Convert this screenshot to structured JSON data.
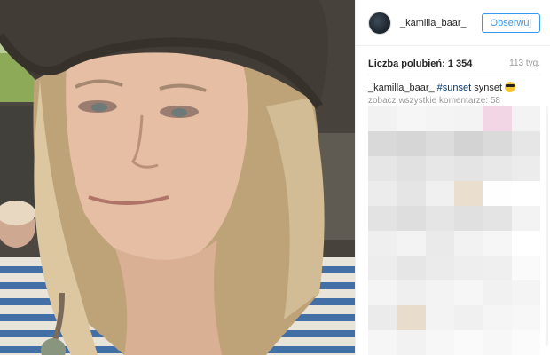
{
  "post": {
    "username": "_kamilla_baar_",
    "follow_label": "Obserwuj",
    "likes_label": "Liczba polubień:",
    "likes_count": "1 354",
    "age": "113 tyg.",
    "caption": {
      "user": "_kamilla_baar_",
      "hashtag": "#sunset",
      "text": "synset",
      "emoji": "sunglasses-emoji"
    },
    "view_all_comments": "zobacz wszystkie komentarze: 58"
  },
  "colors": {
    "accent": "#3897f0",
    "hashtag": "#003569",
    "muted": "#999999",
    "text": "#262626"
  },
  "blur_cells": [
    "#f2f2f2",
    "#f6f6f6",
    "#f4f4f4",
    "#f3f3f3",
    "#f3d6e6",
    "#f3f3f3",
    "#d9d9d9",
    "#d6d6d6",
    "#dcdcdc",
    "#d3d3d3",
    "#dadada",
    "#e6e6e6",
    "#e6e6e6",
    "#e1e1e1",
    "#e7e7e7",
    "#e4e4e4",
    "#e8e8e8",
    "#ececec",
    "#ececec",
    "#e5e5e5",
    "#f0f0f0",
    "#eadfcf",
    "#fefefe",
    "#ffffff",
    "#e3e3e3",
    "#dedede",
    "#e5e5e5",
    "#e0e0e0",
    "#e4e4e4",
    "#f3f3f3",
    "#efefef",
    "#f3f3f3",
    "#eaeaea",
    "#f2f2f2",
    "#f6f6f6",
    "#ffffff",
    "#ededed",
    "#e6e6e6",
    "#ebebeb",
    "#eeeeee",
    "#efefef",
    "#fafafa",
    "#f4f4f4",
    "#efefef",
    "#f3f3f3",
    "#f6f6f6",
    "#f1f1f1",
    "#f4f4f4",
    "#ebebeb",
    "#e8dccd",
    "#f3f3f3",
    "#f0f0f0",
    "#f5f5f5",
    "#f7f7f7",
    "#f6f6f6",
    "#f2f2f2",
    "#f7f7f7",
    "#fafafa",
    "#f7f7f7",
    "#fbfbfb"
  ]
}
